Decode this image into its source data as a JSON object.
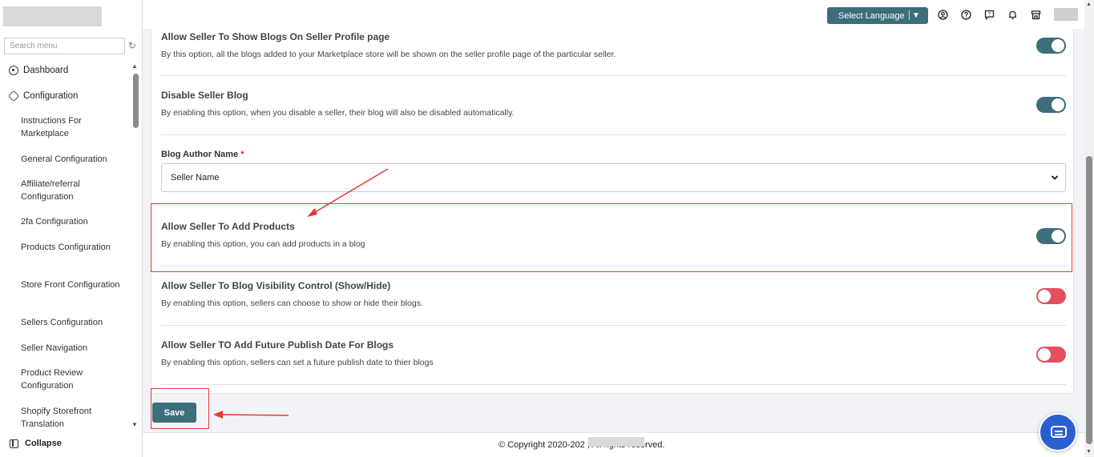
{
  "sidebar": {
    "search_placeholder": "Search menu",
    "top_items": [
      {
        "label": "Dashboard",
        "icon": "dashboard-icon"
      },
      {
        "label": "Configuration",
        "icon": "configuration-icon"
      }
    ],
    "sub_items": [
      {
        "label": "Instructions For Marketplace"
      },
      {
        "label": "General Configuration"
      },
      {
        "label": "Affiliate/referral Configuration"
      },
      {
        "label": "2fa Configuration"
      },
      {
        "label": "Products Configuration"
      },
      {
        "label": "Store Front Configuration"
      },
      {
        "label": "Sellers Configuration"
      },
      {
        "label": "Seller Navigation"
      },
      {
        "label": "Product Review Configuration"
      },
      {
        "label": "Shopify Storefront Translation"
      }
    ],
    "collapse_label": "Collapse"
  },
  "topbar": {
    "language_label": "Select Language",
    "icons": [
      "account-icon",
      "help-icon",
      "support-icon",
      "notification-icon",
      "store-icon"
    ]
  },
  "settings": [
    {
      "title": "Allow Seller To Show Blogs On Seller Profile page",
      "description": "By this option, all the blogs added to your Marketplace store will be shown on the seller profile page of the particular seller.",
      "enabled": true
    },
    {
      "title": "Disable Seller Blog",
      "description": "By enabling this option, when you disable a seller, their blog will also be disabled automatically.",
      "enabled": true
    },
    {
      "title": "Allow Seller To Add Products",
      "description": "By enabling this option, you can add products in a blog",
      "enabled": true
    },
    {
      "title": "Allow Seller To Blog Visibility Control (Show/Hide)",
      "description": "By enabling this option, sellers can choose to show or hide their blogs.",
      "enabled": false
    },
    {
      "title": "Allow Seller TO Add Future Publish Date For Blogs",
      "description": "By enabling this option, sellers can set a future publish date to thier blogs",
      "enabled": false
    }
  ],
  "author_field": {
    "label": "Blog Author Name",
    "required_mark": "*",
    "value": "Seller Name"
  },
  "save_label": "Save",
  "footer": {
    "copyright": "© Copyright 2020-202          , All rights reserved."
  },
  "colors": {
    "primary": "#3d6e7a",
    "toggle_off": "#e3505f",
    "annotation": "#e53935",
    "chat": "#2b5fd0"
  }
}
